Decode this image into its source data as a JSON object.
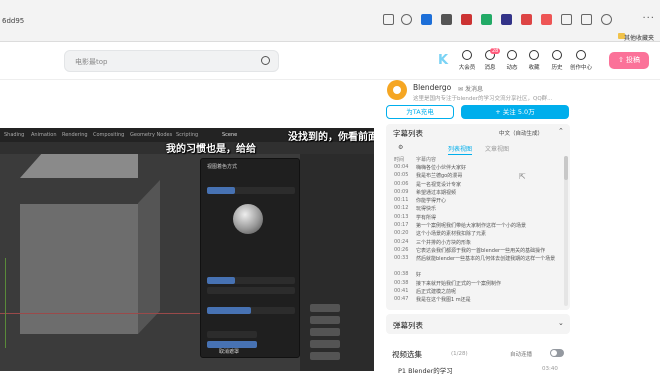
{
  "browser": {
    "url": "6dd95",
    "bookmark_label": "其他收藏夹"
  },
  "header": {
    "search_placeholder": "电影最top",
    "nav": [
      {
        "label": "大会员"
      },
      {
        "label": "消息"
      },
      {
        "label": "动态"
      },
      {
        "label": "收藏"
      },
      {
        "label": "历史"
      },
      {
        "label": "创作中心"
      }
    ],
    "message_badge": "28",
    "upload_label": "投稿"
  },
  "video": {
    "subtitle_left": "我的习惯也是，给给",
    "subtitle_right": "没找到的，你看前面去",
    "tabs": [
      "Shading",
      "Animation",
      "Rendering",
      "Compositing",
      "Geometry Nodes",
      "Scripting"
    ],
    "scene_label": "Scene",
    "popover_title": "视图着色方式",
    "popover_cancel": "取消遮罩"
  },
  "uploader": {
    "name": "Blendergo",
    "message": "发消息",
    "desc": "这里是国内专注于blender的学习交流分享社区，QQ群..."
  },
  "buttons": {
    "charge": "为TA充电",
    "follow": "+ 关注 5.0万"
  },
  "subtitles_panel": {
    "title": "字幕列表",
    "language": "中文（自动生成）",
    "tabs": {
      "active": "列表视图",
      "inactive": "文章视图"
    },
    "col_time": "时间",
    "col_content": "字幕内容",
    "rows": [
      {
        "t": "00:04",
        "c": "嗨嗨各位小伙伴大家好"
      },
      {
        "t": "00:05",
        "c": "我是布兰德go的漫哥"
      },
      {
        "t": "00:06",
        "c": "是一名视觉设计专家"
      },
      {
        "t": "00:09",
        "c": "希望通过本期视频"
      },
      {
        "t": "00:11",
        "c": "你能学得开心"
      },
      {
        "t": "00:12",
        "c": "玩得快乐"
      },
      {
        "t": "00:13",
        "c": "学有所得"
      },
      {
        "t": "00:17",
        "c": "第一个案例呢我们带给大家制作这样一个小的场景"
      },
      {
        "t": "00:20",
        "c": "这个小场景的素材我扣除了元素"
      },
      {
        "t": "00:24",
        "c": "三个并排的小方块的形象"
      },
      {
        "t": "00:26",
        "c": "它表达会我们都源于我的一首blender一些用关的基础操作"
      },
      {
        "t": "00:33",
        "c": "然后就能blender一些基本的几何体去创建我期的这样一个场景"
      },
      {
        "t": "00:38",
        "c": "好"
      },
      {
        "t": "00:38",
        "c": "接下来就开始我们正式的一个案例制作"
      },
      {
        "t": "00:41",
        "c": "后正式建模之前呢"
      },
      {
        "t": "00:47",
        "c": "我是在这个我图1 m还是"
      }
    ]
  },
  "danmu_panel": {
    "title": "弹幕列表"
  },
  "collection": {
    "title": "视频选集",
    "count": "(1/28)",
    "autoplay": "自动连播",
    "first_item": "P1 Blender的学习",
    "first_time": "03:40"
  },
  "colors": {
    "accent": "#00aeec",
    "pink": "#fb7299"
  }
}
